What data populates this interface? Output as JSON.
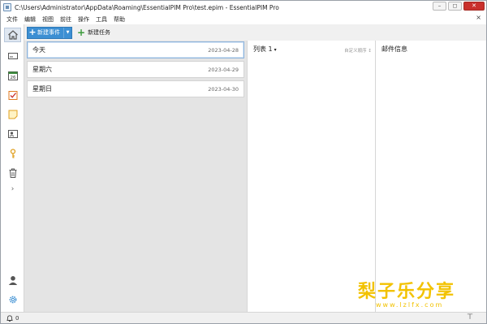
{
  "window": {
    "title": "C:\\Users\\Administrator\\AppData\\Roaming\\EssentialPIM Pro\\test.epim - EssentialPIM Pro",
    "min_glyph": "–",
    "restore_glyph": "◻",
    "close_glyph": "✕"
  },
  "menu": {
    "items": [
      "文件",
      "编辑",
      "视图",
      "前往",
      "操作",
      "工具",
      "帮助"
    ],
    "close_glyph": "×"
  },
  "sidebar": {
    "items": [
      {
        "name": "home",
        "icon": "home-icon",
        "active": true
      },
      {
        "name": "mail",
        "icon": "mail-icon"
      },
      {
        "name": "calendar",
        "icon": "calendar-icon",
        "label": "26"
      },
      {
        "name": "tasks",
        "icon": "tasks-icon"
      },
      {
        "name": "notes",
        "icon": "notes-icon"
      },
      {
        "name": "contacts",
        "icon": "contacts-icon"
      },
      {
        "name": "passwords",
        "icon": "key-icon"
      },
      {
        "name": "trash",
        "icon": "trash-icon"
      }
    ],
    "expand_glyph": "›"
  },
  "toolbar": {
    "new_event_plus": "+",
    "new_event_label": "新建事件",
    "new_event_dropdown": "▼",
    "new_task_plus": "+",
    "new_task_label": "新建任务"
  },
  "days": [
    {
      "name": "今天",
      "date": "2023-04-28",
      "selected": true
    },
    {
      "name": "星期六",
      "date": "2023-04-29"
    },
    {
      "name": "星期日",
      "date": "2023-04-30"
    }
  ],
  "list": {
    "title": "列表 1",
    "caret": "▾",
    "sort_label": "自定义顺序",
    "sort_glyph": "↕"
  },
  "mail": {
    "title": "邮件信息"
  },
  "watermark": {
    "text": "梨子乐分享",
    "url": "www.lzlfx.com"
  },
  "status": {
    "reminder_count": "0",
    "pin_glyph": "⊤"
  },
  "colors": {
    "accent": "#3c8fd3",
    "task_green": "#3a9a3a",
    "close_red": "#c9302c",
    "watermark": "#f2c200"
  }
}
